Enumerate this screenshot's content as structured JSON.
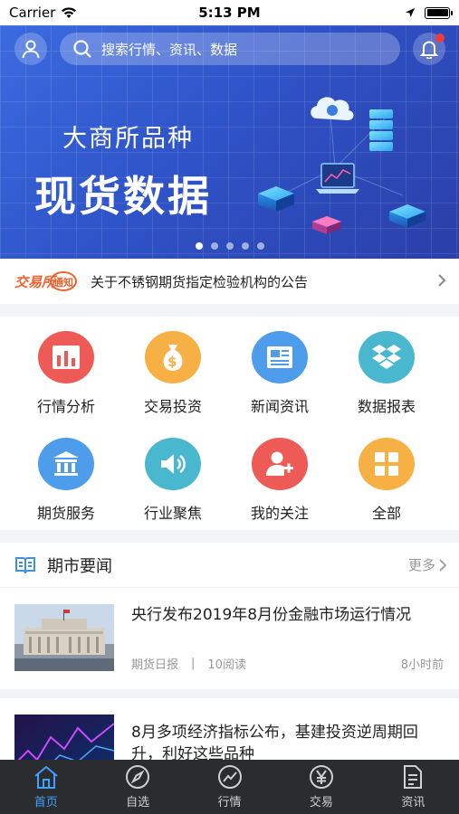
{
  "status_bar": {
    "carrier": "Carrier",
    "time": "5:13 PM"
  },
  "search": {
    "placeholder": "搜索行情、资讯、数据"
  },
  "banner": {
    "subtitle": "大商所品种",
    "title": "现货数据",
    "page_count": 5,
    "active_page": 1
  },
  "notice": {
    "logo_text": "交易所通知",
    "text": "关于不锈钢期货指定检验机构的公告"
  },
  "shortcuts": [
    {
      "label": "行情分析",
      "icon": "bar-chart-icon",
      "color": "#ee5b56"
    },
    {
      "label": "交易投资",
      "icon": "money-bag-icon",
      "color": "#f6b043"
    },
    {
      "label": "新闻资讯",
      "icon": "newspaper-icon",
      "color": "#4e9cec"
    },
    {
      "label": "数据报表",
      "icon": "dropbox-icon",
      "color": "#49b8cf"
    },
    {
      "label": "期货服务",
      "icon": "bank-icon",
      "color": "#4e9cec"
    },
    {
      "label": "行业聚焦",
      "icon": "speaker-icon",
      "color": "#49b8cf"
    },
    {
      "label": "我的关注",
      "icon": "add-user-icon",
      "color": "#ee5b56"
    },
    {
      "label": "全部",
      "icon": "grid-icon",
      "color": "#f6b043"
    }
  ],
  "news_section": {
    "title": "期市要闻",
    "more": "更多"
  },
  "news": [
    {
      "title": "央行发布2019年8月份金融市场运行情况",
      "source": "期货日报",
      "reads": "10阅读",
      "time": "8小时前"
    },
    {
      "title": "8月多项经济指标公布，基建投资逆周期回升，利好这些品种",
      "source": "",
      "reads": "",
      "time": ""
    }
  ],
  "tabbar": {
    "items": [
      {
        "label": "首页",
        "icon": "home-icon"
      },
      {
        "label": "自选",
        "icon": "compass-icon"
      },
      {
        "label": "行情",
        "icon": "trend-icon"
      },
      {
        "label": "交易",
        "icon": "yen-icon"
      },
      {
        "label": "资讯",
        "icon": "document-icon"
      }
    ],
    "active": 0
  },
  "colors": {
    "active_tab": "#3ea0ff",
    "tabbar_bg": "#2b2c30",
    "banner_bg": "#3160d6"
  }
}
